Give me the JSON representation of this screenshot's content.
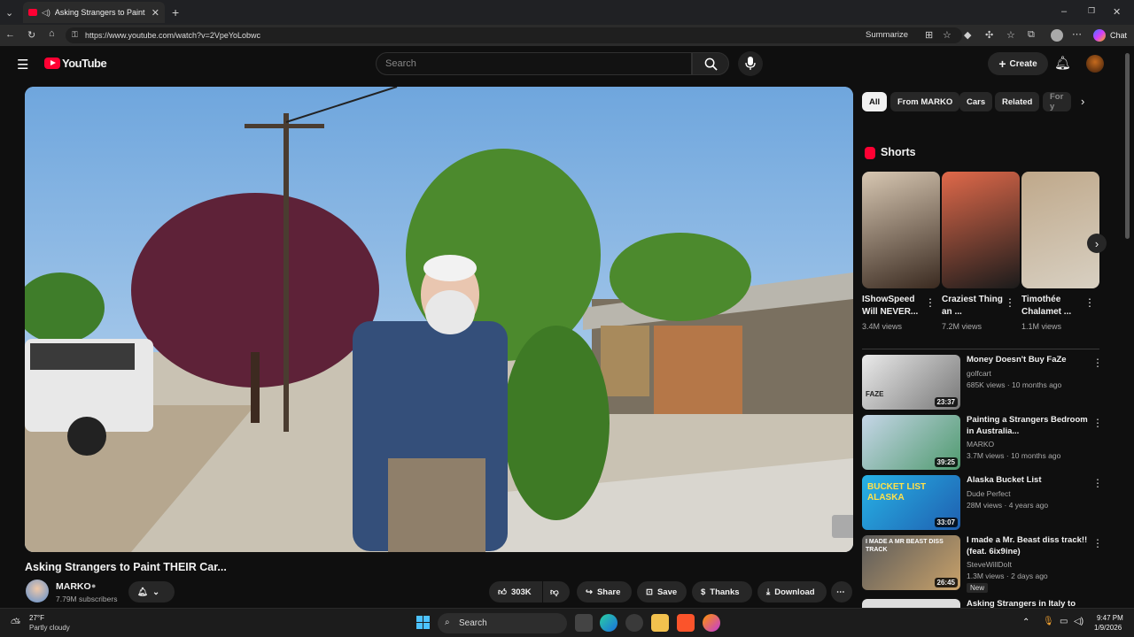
{
  "browser": {
    "tab_title": "Asking Strangers to Paint THEIR",
    "url": "https://www.youtube.com/watch?v=2VpeYoLobwc",
    "summarize": "Summarize",
    "chat": "Chat"
  },
  "masthead": {
    "logo": "YouTube",
    "search_placeholder": "Search",
    "create": "Create"
  },
  "video": {
    "title": "Asking Strangers to Paint THEIR Car...",
    "channel": "MARKO",
    "subscribers": "7.79M subscribers",
    "likes": "303K",
    "share": "Share",
    "save": "Save",
    "thanks": "Thanks",
    "download": "Download"
  },
  "chips": [
    "All",
    "From MARKO",
    "Cars",
    "Related",
    "For y"
  ],
  "shorts": {
    "heading": "Shorts",
    "items": [
      {
        "title": "IShowSpeed Will NEVER...",
        "views": "3.4M views"
      },
      {
        "title": "Craziest Thing an ...",
        "views": "7.2M views"
      },
      {
        "title": "Timothée Chalamet ...",
        "views": "1.1M views"
      }
    ]
  },
  "recommendations": [
    {
      "title": "Money Doesn't Buy FaZe",
      "channel": "golfcart",
      "meta": "685K views · 10 months ago",
      "duration": "23:37",
      "thumb_text": "FAZE",
      "badge": ""
    },
    {
      "title": "Painting a Strangers Bedroom in Australia...",
      "channel": "MARKO",
      "meta": "3.7M views · 10 months ago",
      "duration": "39:25",
      "thumb_text": "",
      "badge": ""
    },
    {
      "title": "Alaska Bucket List",
      "channel": "Dude Perfect",
      "meta": "28M views · 4 years ago",
      "duration": "33:07",
      "thumb_text": "BUCKET LIST ALASKA",
      "badge": ""
    },
    {
      "title": "I made a Mr. Beast diss track!! (feat. 6ix9ine)",
      "channel": "SteveWillDoIt",
      "meta": "1.3M views · 2 days ago",
      "duration": "26:45",
      "thumb_text": "I MADE A MR BEAST DISS TRACK",
      "badge": "New"
    },
    {
      "title": "Asking Strangers in Italy to",
      "channel": "",
      "meta": "",
      "duration": "",
      "thumb_text": "",
      "badge": ""
    }
  ],
  "taskbar": {
    "temp": "27°F",
    "weather": "Partly cloudy",
    "search": "Search",
    "time": "9:47 PM",
    "date": "1/9/2026"
  },
  "colors": {
    "accent_red": "#ff0033",
    "bg": "#0f0f0f",
    "surface": "#272727"
  }
}
